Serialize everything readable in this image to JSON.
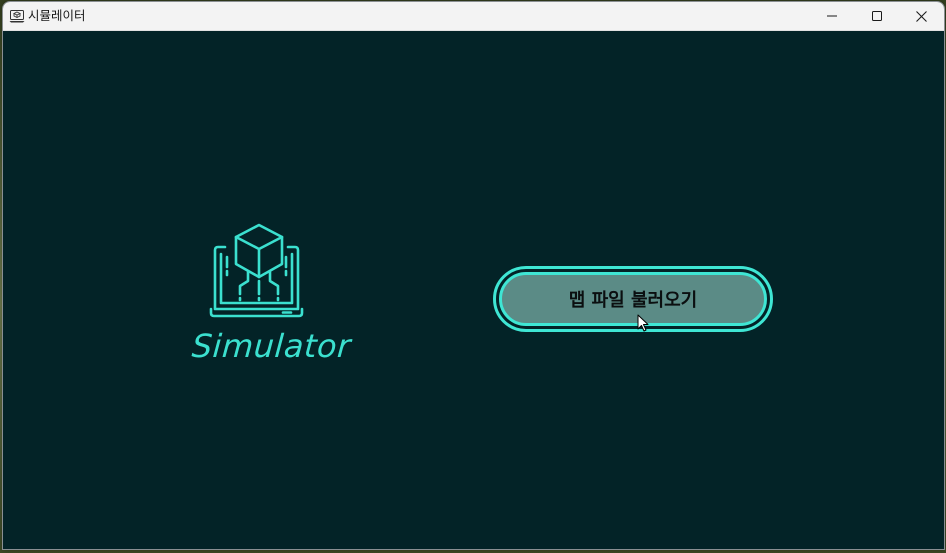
{
  "window": {
    "title": "시뮬레이터",
    "controls": {
      "minimize_icon": "minimize-icon",
      "maximize_icon": "maximize-icon",
      "close_icon": "close-icon"
    }
  },
  "main": {
    "logo": {
      "icon": "laptop-cube-icon",
      "text": "Simulator"
    },
    "load_map_button": {
      "label": "맵 파일 불러오기"
    }
  },
  "colors": {
    "background": "#032327",
    "accent": "#3fe6d4",
    "button_fill": "#5b8b86",
    "titlebar": "#f3f3f3"
  }
}
